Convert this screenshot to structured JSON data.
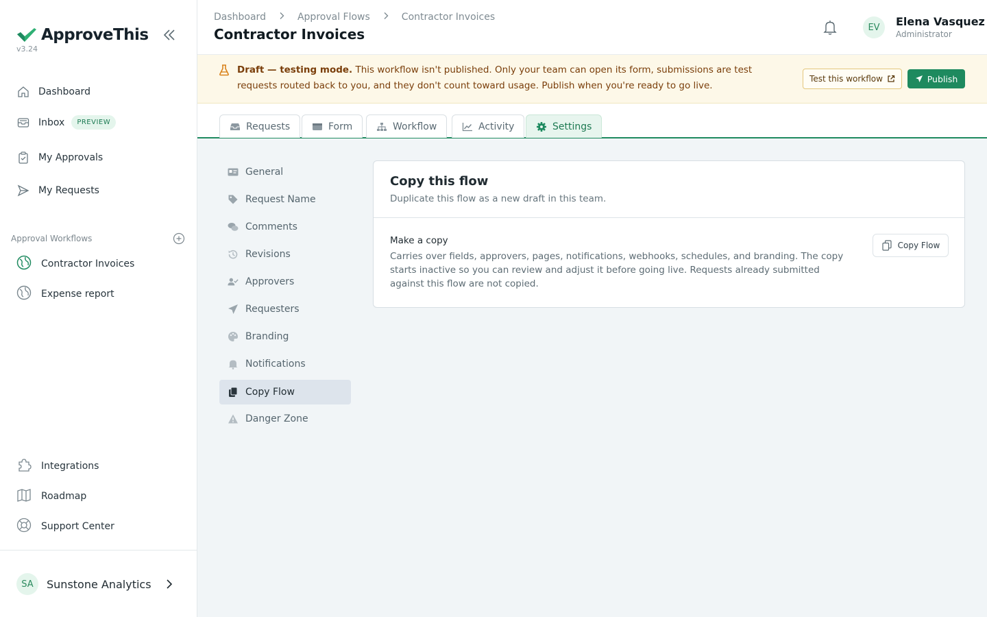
{
  "app": {
    "name": "ApproveThis",
    "version": "v3.24"
  },
  "sidebar": {
    "nav": [
      {
        "label": "Dashboard",
        "icon": "home-icon"
      },
      {
        "label": "Inbox",
        "icon": "inbox-icon",
        "badge": "PREVIEW"
      },
      {
        "label": "My Approvals",
        "icon": "clipboard-check-icon"
      },
      {
        "label": "My Requests",
        "icon": "send-icon"
      }
    ],
    "workflows_label": "Approval Workflows",
    "workflows": [
      {
        "label": "Contractor Invoices",
        "icon": "globe-icon",
        "active": true
      },
      {
        "label": "Expense report",
        "icon": "globe-icon",
        "active": false
      }
    ],
    "bottom": [
      {
        "label": "Integrations",
        "icon": "puzzle-icon"
      },
      {
        "label": "Roadmap",
        "icon": "map-icon"
      },
      {
        "label": "Support Center",
        "icon": "lifebuoy-icon"
      }
    ],
    "org": {
      "initials": "SA",
      "name": "Sunstone Analytics"
    }
  },
  "header": {
    "breadcrumbs": [
      "Dashboard",
      "Approval Flows",
      "Contractor Invoices"
    ],
    "title": "Contractor Invoices",
    "user": {
      "initials": "EV",
      "name": "Elena Vasquez",
      "role": "Administrator"
    }
  },
  "banner": {
    "strong": "Draft — testing mode.",
    "text": " This workflow isn't published. Only your team can open its form, submissions are test requests routed back to you, and they don't count toward usage. Publish when you're ready to go live.",
    "test_label": "Test this workflow",
    "publish_label": "Publish"
  },
  "tabs": [
    {
      "label": "Requests",
      "icon": "inbox-icon"
    },
    {
      "label": "Form",
      "icon": "form-icon"
    },
    {
      "label": "Workflow",
      "icon": "sitemap-icon"
    },
    {
      "label": "Activity",
      "icon": "chart-line-icon"
    },
    {
      "label": "Settings",
      "icon": "gear-icon",
      "active": true
    }
  ],
  "settings_nav": [
    {
      "label": "General",
      "icon": "id-card-icon"
    },
    {
      "label": "Request Name",
      "icon": "tag-icon"
    },
    {
      "label": "Comments",
      "icon": "comments-icon"
    },
    {
      "label": "Revisions",
      "icon": "history-icon"
    },
    {
      "label": "Approvers",
      "icon": "user-check-icon"
    },
    {
      "label": "Requesters",
      "icon": "paper-plane-icon"
    },
    {
      "label": "Branding",
      "icon": "palette-icon"
    },
    {
      "label": "Notifications",
      "icon": "bell-icon"
    },
    {
      "label": "Copy Flow",
      "icon": "copy-icon",
      "active": true
    },
    {
      "label": "Danger Zone",
      "icon": "warning-icon"
    }
  ],
  "card": {
    "title": "Copy this flow",
    "subtitle": "Duplicate this flow as a new draft in this team.",
    "make_title": "Make a copy",
    "make_desc": "Carries over fields, approvers, pages, notifications, webhooks, schedules, and branding. The copy starts inactive so you can review and adjust it before going live. Requests already submitted against this flow are not copied.",
    "button_label": "Copy Flow"
  },
  "colors": {
    "brand": "#1e8a5f",
    "banner_bg": "#fdf8e8",
    "banner_text": "#7a3e0a",
    "main_bg": "#f1f5f7"
  }
}
